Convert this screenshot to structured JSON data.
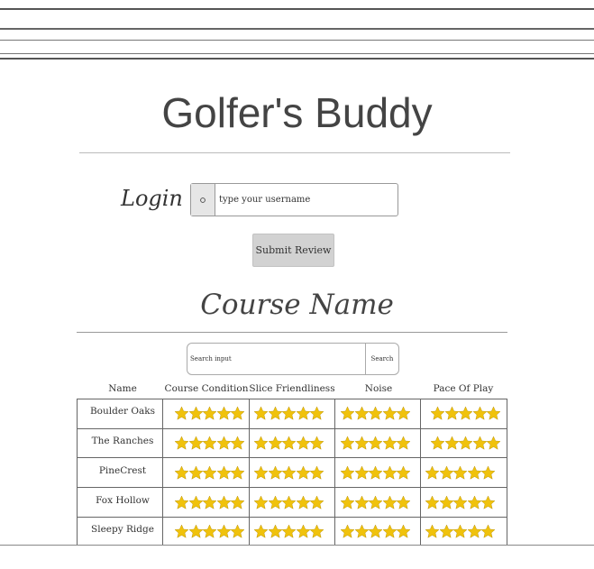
{
  "app": {
    "title": "Golfer's Buddy"
  },
  "login": {
    "label": "Login",
    "icon": "user-icon",
    "placeholder": "type your username"
  },
  "submit": {
    "label": "Submit Review"
  },
  "course": {
    "title": "Course Name"
  },
  "search": {
    "placeholder": "Search input",
    "button_label": "Search"
  },
  "table": {
    "headers": [
      "Name",
      "Course Condition",
      "Slice Friendliness",
      "Noise",
      "Pace Of Play"
    ],
    "rows": [
      {
        "name": "Boulder Oaks",
        "ratings": [
          5,
          5,
          5,
          5,
          5
        ]
      },
      {
        "name": "The Ranches",
        "ratings": [
          5,
          5,
          5,
          5,
          5
        ]
      },
      {
        "name": "PineCrest",
        "ratings": [
          5,
          5,
          5,
          5,
          5
        ]
      },
      {
        "name": "Fox Hollow",
        "ratings": [
          5,
          5,
          5,
          5,
          5
        ]
      },
      {
        "name": "Sleepy Ridge",
        "ratings": [
          5,
          5,
          5,
          5,
          5
        ]
      }
    ],
    "star_color": "#f0c20c",
    "star_icon": "star-icon"
  }
}
